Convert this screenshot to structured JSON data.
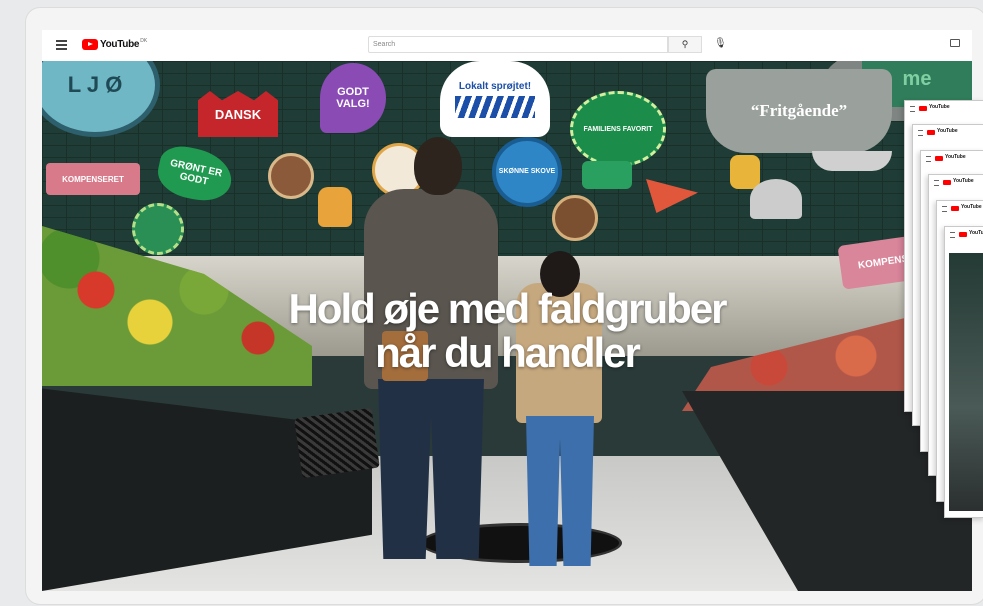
{
  "youtube": {
    "logo_text": "YouTube",
    "logo_sup": "DK",
    "search_placeholder": "Search",
    "search_button_glyph": "⚲",
    "mic_glyph": "🎙",
    "icons": [
      "menu-icon",
      "youtube-logo-icon",
      "search-icon",
      "mic-icon",
      "cast-icon"
    ]
  },
  "video": {
    "headline_line1": "Hold øje med faldgruber",
    "headline_line2": "når du handler",
    "stickers": {
      "dial": "L J Ø",
      "dansk": "DANSK",
      "godt_valg": "GODT VALG!",
      "lokalt": "Lokalt sprøjtet!",
      "familiens": "FAMILIENS FAVORIT",
      "fritgaende": "“Fritgående”",
      "kompenseret": "KOMPENSERET",
      "gront": "GRØNT ER GODT",
      "skonne": "SKØNNE SKOVE",
      "kompenseret2": "KOMPENSER",
      "top_right": "me"
    }
  },
  "stacked_windows": {
    "logo_text": "YouTube",
    "count": 6
  },
  "colors": {
    "yt_red": "#ff0000",
    "wall_green": "#1f3d36",
    "headline": "#ffffff"
  }
}
